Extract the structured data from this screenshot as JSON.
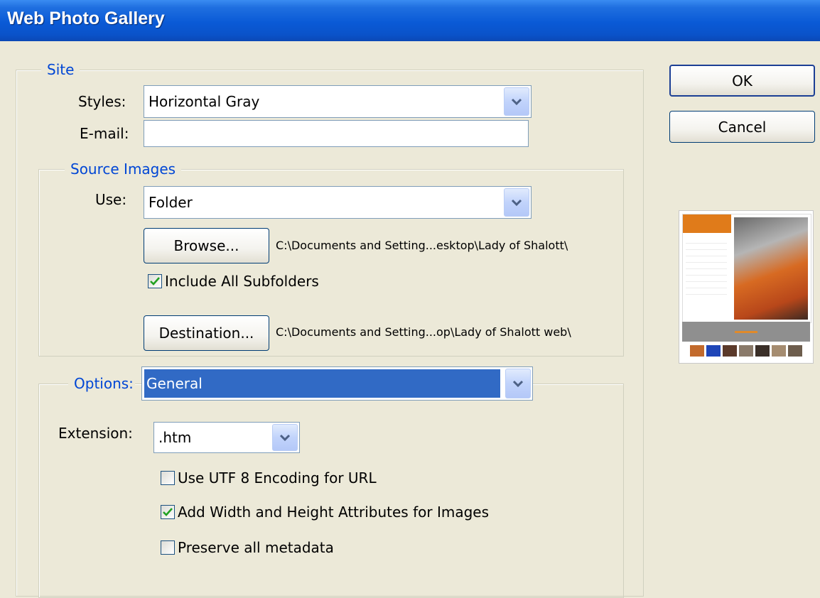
{
  "window": {
    "title": "Web Photo Gallery"
  },
  "site": {
    "legend": "Site",
    "styles_label": "Styles:",
    "styles_value": "Horizontal Gray",
    "email_label": "E-mail:",
    "email_value": ""
  },
  "source_images": {
    "legend": "Source Images",
    "use_label": "Use:",
    "use_value": "Folder",
    "browse_label": "Browse...",
    "browse_path": "C:\\Documents and Setting...esktop\\Lady of Shalott\\",
    "include_subfolders_label": "Include All Subfolders",
    "include_subfolders_checked": true,
    "destination_label": "Destination...",
    "destination_path": "C:\\Documents and Setting...op\\Lady of Shalott web\\"
  },
  "options": {
    "label": "Options:",
    "value": "General",
    "extension_label": "Extension:",
    "extension_value": ".htm",
    "utf8_label": "Use UTF 8 Encoding for URL",
    "utf8_checked": false,
    "width_height_label": "Add Width and Height Attributes for Images",
    "width_height_checked": true,
    "metadata_label": "Preserve all metadata",
    "metadata_checked": false
  },
  "buttons": {
    "ok_label": "OK",
    "cancel_label": "Cancel"
  },
  "colors": {
    "titlebar": "#0a5ad6",
    "legend_text": "#0046d5",
    "selection": "#316ac5",
    "dialog_bg": "#ece9d8",
    "preview_accent": "#e07b1a"
  }
}
